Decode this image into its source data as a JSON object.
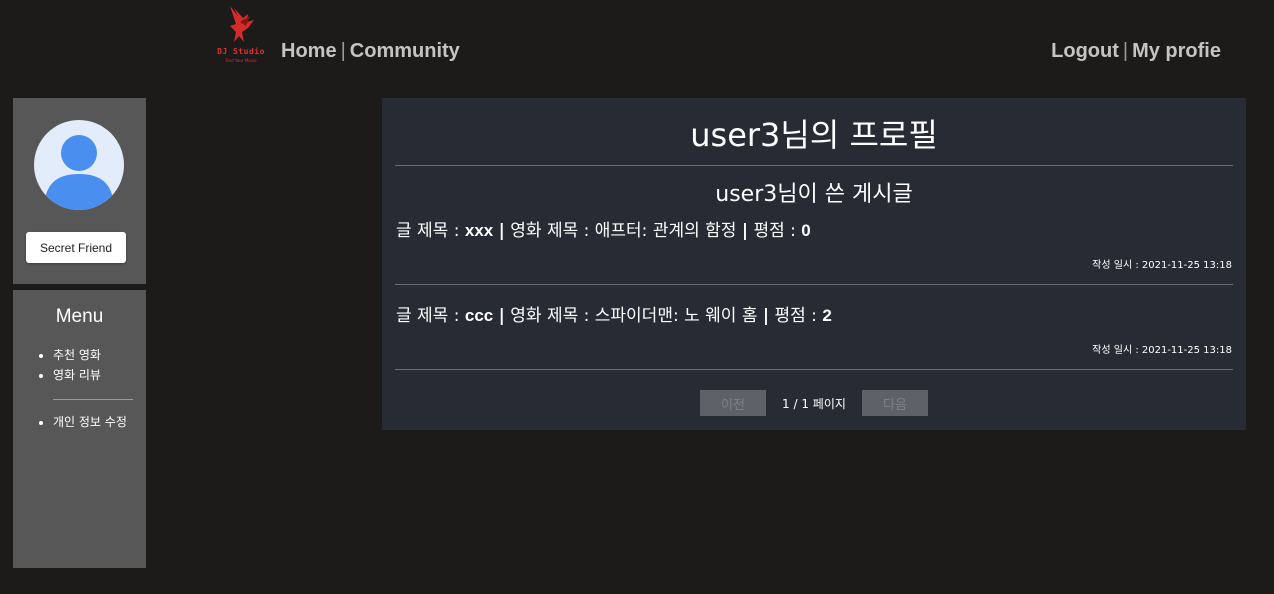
{
  "header": {
    "logo": {
      "brand": "DJ Studio",
      "tagline": "Find Your Movie",
      "icon": "bird-logo-icon",
      "color": "#d33"
    },
    "nav_left": [
      "Home",
      "Community"
    ],
    "nav_right": [
      "Logout",
      "My profie"
    ],
    "separator": "|"
  },
  "sidebar": {
    "avatar_icon": "user-avatar-icon",
    "secret_button": "Secret Friend",
    "menu_title": "Menu",
    "menu_items": [
      "추천 영화",
      "영화 리뷰"
    ],
    "menu_items_2": [
      "개인 정보 수정"
    ]
  },
  "main": {
    "title": "user3님의 프로필",
    "section_title": "user3님이 쓴 게시글",
    "posts": [
      {
        "title_label": "글 제목 : ",
        "title": "xxx",
        "movie_label": " 영화 제목 : 애프터: 관계의 함정 ",
        "rating_label": " 평점 : ",
        "rating": "0",
        "date": "작성 일시 : 2021-11-25 13:18"
      },
      {
        "title_label": "글 제목 : ",
        "title": "ccc",
        "movie_label": " 영화 제목 : 스파이더맨: 노 웨이 홈 ",
        "rating_label": " 평점 : ",
        "rating": "2",
        "date": "작성 일시 : 2021-11-25 13:18"
      }
    ],
    "pager": {
      "prev": "이전",
      "info": "1 / 1 페이지",
      "next": "다음"
    }
  },
  "colors": {
    "background": "#1c1b19",
    "panel": "#272b33",
    "sidebar": "#575757",
    "avatar": "#4a8ff0"
  }
}
